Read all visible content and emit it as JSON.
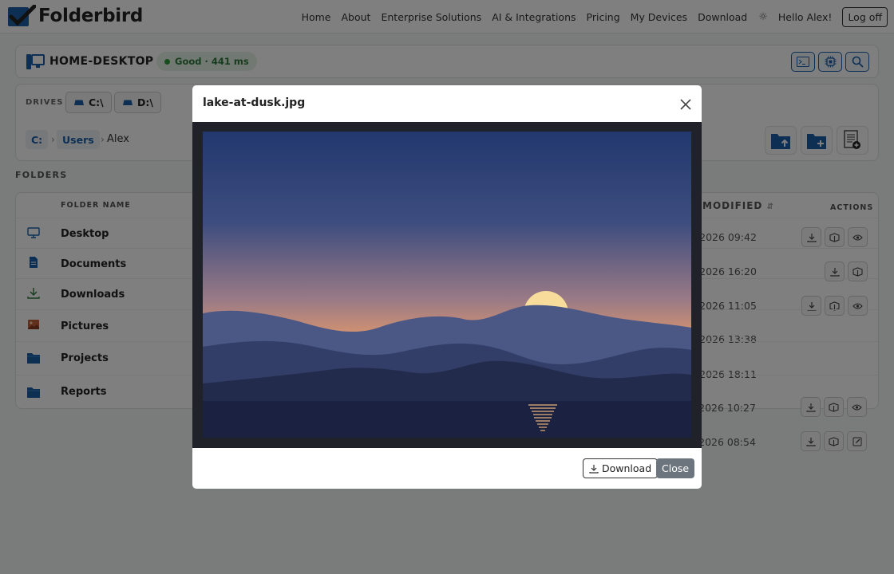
{
  "brand": {
    "name": "Folderbird"
  },
  "nav": {
    "links": [
      "Home",
      "About",
      "Enterprise Solutions",
      "AI & Integrations",
      "Pricing",
      "My Devices",
      "Download"
    ],
    "greeting": "Hello Alex!",
    "logoff": "Log off",
    "theme_icon": "sun-icon"
  },
  "device": {
    "name": "HOME-DESKTOP",
    "status": "Good · 441 ms",
    "tools": [
      "terminal-icon",
      "cpu-icon",
      "search-icon"
    ]
  },
  "drives": {
    "label": "DRIVES",
    "items": [
      "C:\\",
      "D:\\"
    ]
  },
  "breadcrumb": {
    "items": [
      "C:",
      "Users"
    ],
    "current": "Alex"
  },
  "folders": {
    "heading": "FOLDERS",
    "col_name": "FOLDER NAME",
    "col_modified": "ST MODIFIED",
    "sort_glyph": "⇵",
    "col_actions": "ACTIONS",
    "rows": [
      {
        "name": "Desktop",
        "modified": "06/2026 09:42",
        "icon": "monitor-icon"
      },
      {
        "name": "Documents",
        "modified": "06/2026 16:20",
        "icon": "document-icon"
      },
      {
        "name": "Downloads",
        "modified": "06/2026 11:05",
        "icon": "download-icon"
      },
      {
        "name": "Pictures",
        "modified": "06/2026 13:38",
        "icon": "picture-icon"
      },
      {
        "name": "Projects",
        "modified": "06/2026 18:11",
        "icon": "folder-icon"
      },
      {
        "name": "Reports",
        "modified": "06/2026 10:27",
        "icon": "folder-icon"
      },
      {
        "name": "",
        "modified": "06/2026 08:54",
        "icon": ""
      }
    ]
  },
  "modal": {
    "title": "lake-at-dusk.jpg",
    "download_label": "Download",
    "close_label": "Close"
  },
  "colors": {
    "accent": "#1a5ea8",
    "status_green": "#2d9a3a",
    "sky_top": "#22386e",
    "sky_horizon": "#e49a6a",
    "sun": "#f8dc9c"
  }
}
